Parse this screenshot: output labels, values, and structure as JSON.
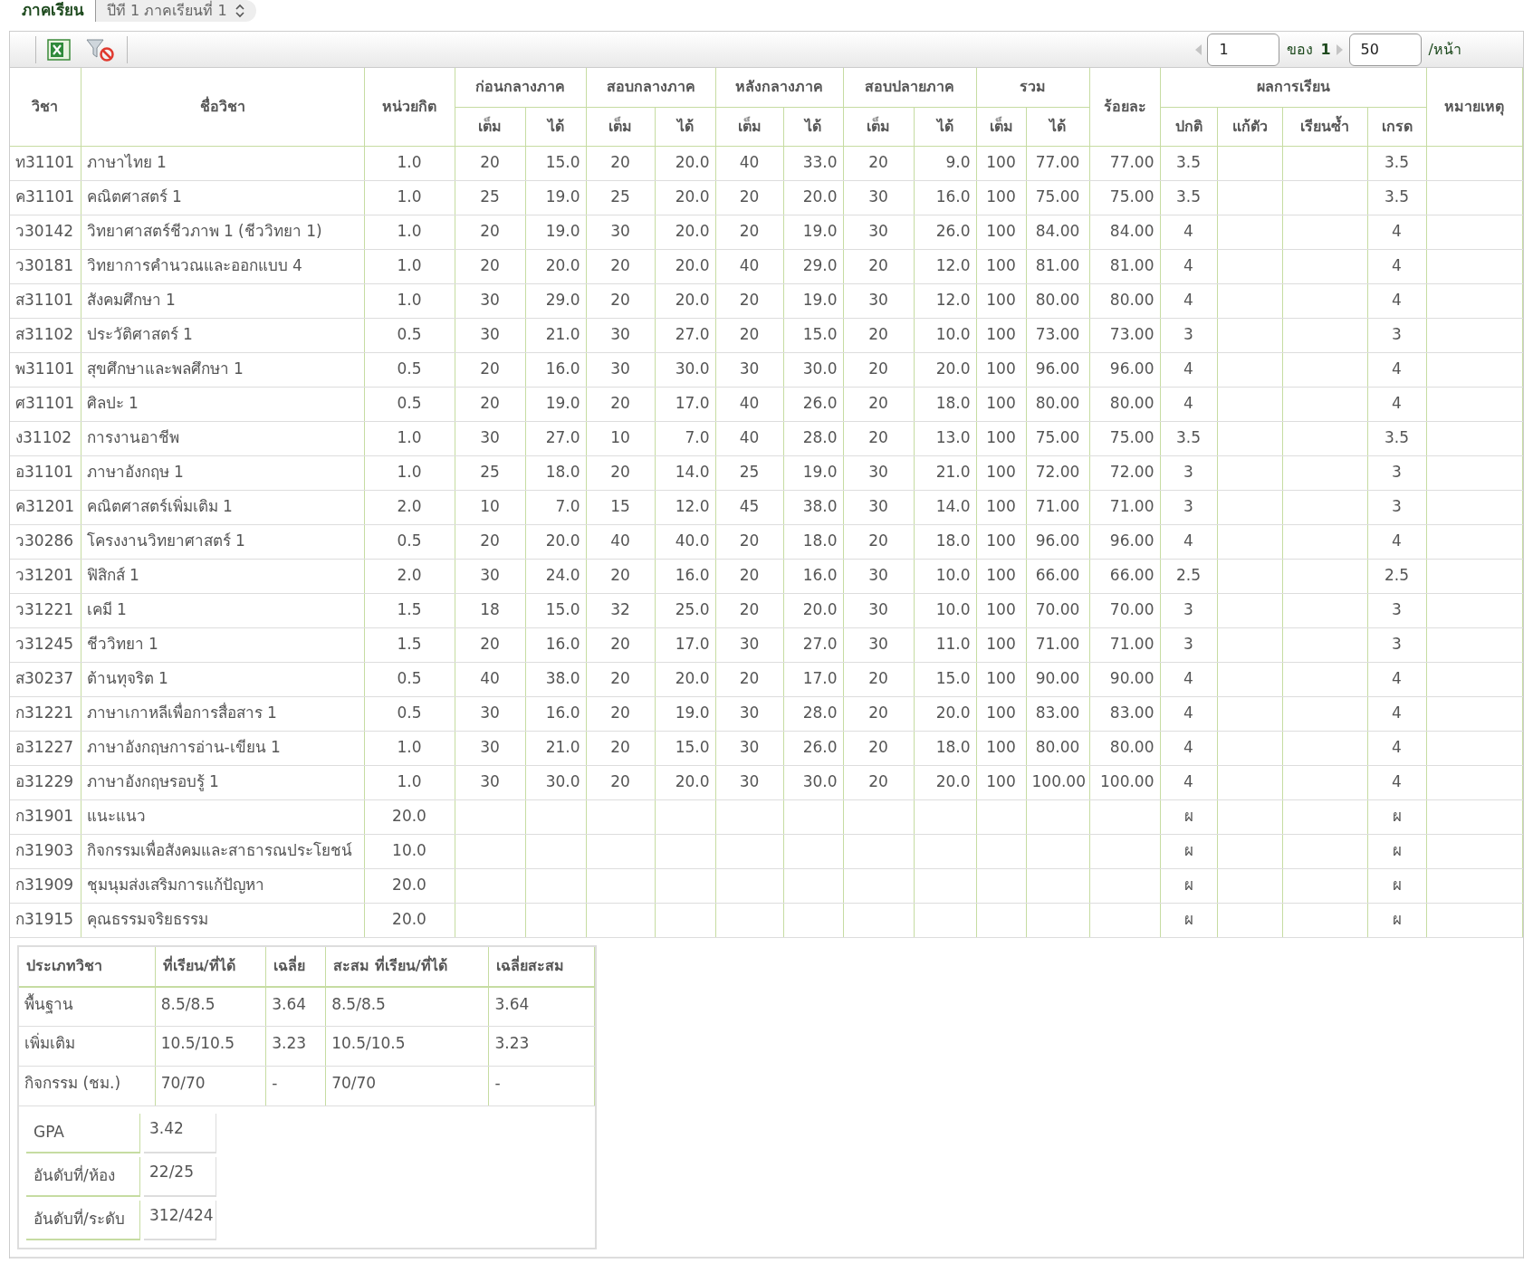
{
  "term": {
    "label": "ภาคเรียน",
    "value": "ปีที 1 ภาคเรียนที่ 1"
  },
  "pager": {
    "page": "1",
    "of": "ของ",
    "total": "1",
    "per_page": "50",
    "unit": "/หน้า"
  },
  "table": {
    "header_groups": [
      {
        "label": "วิชา"
      },
      {
        "label": "ชื่อวิชา"
      },
      {
        "label": "หน่วยกิต"
      },
      {
        "label": "ก่อนกลางภาค",
        "subcolumns": [
          "เต็ม",
          "ได้"
        ]
      },
      {
        "label": "สอบกลางภาค",
        "subcolumns": [
          "เต็ม",
          "ได้"
        ]
      },
      {
        "label": "หลังกลางภาค",
        "subcolumns": [
          "เต็ม",
          "ได้"
        ]
      },
      {
        "label": "สอบปลายภาค",
        "subcolumns": [
          "เต็ม",
          "ได้"
        ]
      },
      {
        "label": "รวม",
        "subcolumns": [
          "เต็ม",
          "ได้"
        ]
      },
      {
        "label": "ร้อยละ"
      },
      {
        "label": "ผลการเรียน",
        "subcolumns": [
          "ปกติ",
          "แก้ตัว",
          "เรียนซ้ำ",
          "เกรด"
        ]
      },
      {
        "label": "หมายเหตุ"
      }
    ],
    "rows": [
      [
        "ท31101",
        "ภาษาไทย 1",
        "1.0",
        "20",
        "15.0",
        "20",
        "20.0",
        "40",
        "33.0",
        "20",
        "9.0",
        "100",
        "77.00",
        "77.00",
        "3.5",
        null,
        null,
        "3.5",
        null
      ],
      [
        "ค31101",
        "คณิตศาสตร์ 1",
        "1.0",
        "25",
        "19.0",
        "25",
        "20.0",
        "20",
        "20.0",
        "30",
        "16.0",
        "100",
        "75.00",
        "75.00",
        "3.5",
        null,
        null,
        "3.5",
        null
      ],
      [
        "ว30142",
        "วิทยาศาสตร์ชีวภาพ 1 (ชีววิทยา 1)",
        "1.0",
        "20",
        "19.0",
        "30",
        "20.0",
        "20",
        "19.0",
        "30",
        "26.0",
        "100",
        "84.00",
        "84.00",
        "4",
        null,
        null,
        "4",
        null
      ],
      [
        "ว30181",
        "วิทยาการคำนวณและออกแบบ 4",
        "1.0",
        "20",
        "20.0",
        "20",
        "20.0",
        "40",
        "29.0",
        "20",
        "12.0",
        "100",
        "81.00",
        "81.00",
        "4",
        null,
        null,
        "4",
        null
      ],
      [
        "ส31101",
        "สังคมศึกษา 1",
        "1.0",
        "30",
        "29.0",
        "20",
        "20.0",
        "20",
        "19.0",
        "30",
        "12.0",
        "100",
        "80.00",
        "80.00",
        "4",
        null,
        null,
        "4",
        null
      ],
      [
        "ส31102",
        "ประวัติศาสตร์ 1",
        "0.5",
        "30",
        "21.0",
        "30",
        "27.0",
        "20",
        "15.0",
        "20",
        "10.0",
        "100",
        "73.00",
        "73.00",
        "3",
        null,
        null,
        "3",
        null
      ],
      [
        "พ31101",
        "สุขศึกษาและพลศึกษา 1",
        "0.5",
        "20",
        "16.0",
        "30",
        "30.0",
        "30",
        "30.0",
        "20",
        "20.0",
        "100",
        "96.00",
        "96.00",
        "4",
        null,
        null,
        "4",
        null
      ],
      [
        "ศ31101",
        "ศิลปะ 1",
        "0.5",
        "20",
        "19.0",
        "20",
        "17.0",
        "40",
        "26.0",
        "20",
        "18.0",
        "100",
        "80.00",
        "80.00",
        "4",
        null,
        null,
        "4",
        null
      ],
      [
        "ง31102",
        "การงานอาชีพ",
        "1.0",
        "30",
        "27.0",
        "10",
        "7.0",
        "40",
        "28.0",
        "20",
        "13.0",
        "100",
        "75.00",
        "75.00",
        "3.5",
        null,
        null,
        "3.5",
        null
      ],
      [
        "อ31101",
        "ภาษาอังกฤษ 1",
        "1.0",
        "25",
        "18.0",
        "20",
        "14.0",
        "25",
        "19.0",
        "30",
        "21.0",
        "100",
        "72.00",
        "72.00",
        "3",
        null,
        null,
        "3",
        null
      ],
      [
        "ค31201",
        "คณิตศาสตร์เพิ่มเติม 1",
        "2.0",
        "10",
        "7.0",
        "15",
        "12.0",
        "45",
        "38.0",
        "30",
        "14.0",
        "100",
        "71.00",
        "71.00",
        "3",
        null,
        null,
        "3",
        null
      ],
      [
        "ว30286",
        "โครงงานวิทยาศาสตร์ 1",
        "0.5",
        "20",
        "20.0",
        "40",
        "40.0",
        "20",
        "18.0",
        "20",
        "18.0",
        "100",
        "96.00",
        "96.00",
        "4",
        null,
        null,
        "4",
        null
      ],
      [
        "ว31201",
        "ฟิสิกส์ 1",
        "2.0",
        "30",
        "24.0",
        "20",
        "16.0",
        "20",
        "16.0",
        "30",
        "10.0",
        "100",
        "66.00",
        "66.00",
        "2.5",
        null,
        null,
        "2.5",
        null
      ],
      [
        "ว31221",
        "เคมี 1",
        "1.5",
        "18",
        "15.0",
        "32",
        "25.0",
        "20",
        "20.0",
        "30",
        "10.0",
        "100",
        "70.00",
        "70.00",
        "3",
        null,
        null,
        "3",
        null
      ],
      [
        "ว31245",
        "ชีววิทยา 1",
        "1.5",
        "20",
        "16.0",
        "20",
        "17.0",
        "30",
        "27.0",
        "30",
        "11.0",
        "100",
        "71.00",
        "71.00",
        "3",
        null,
        null,
        "3",
        null
      ],
      [
        "ส30237",
        "ต้านทุจริต 1",
        "0.5",
        "40",
        "38.0",
        "20",
        "20.0",
        "20",
        "17.0",
        "20",
        "15.0",
        "100",
        "90.00",
        "90.00",
        "4",
        null,
        null,
        "4",
        null
      ],
      [
        "ก31221",
        "ภาษาเกาหลีเพื่อการสื่อสาร 1",
        "0.5",
        "30",
        "16.0",
        "20",
        "19.0",
        "30",
        "28.0",
        "20",
        "20.0",
        "100",
        "83.00",
        "83.00",
        "4",
        null,
        null,
        "4",
        null
      ],
      [
        "อ31227",
        "ภาษาอังกฤษการอ่าน-เขียน 1",
        "1.0",
        "30",
        "21.0",
        "20",
        "15.0",
        "30",
        "26.0",
        "20",
        "18.0",
        "100",
        "80.00",
        "80.00",
        "4",
        null,
        null,
        "4",
        null
      ],
      [
        "อ31229",
        "ภาษาอังกฤษรอบรู้ 1",
        "1.0",
        "30",
        "30.0",
        "20",
        "20.0",
        "30",
        "30.0",
        "20",
        "20.0",
        "100",
        "100.00",
        "100.00",
        "4",
        null,
        null,
        "4",
        null
      ],
      [
        "ก31901",
        "แนะแนว",
        "20.0",
        null,
        null,
        null,
        null,
        null,
        null,
        null,
        null,
        null,
        null,
        null,
        "ผ",
        null,
        null,
        "ผ",
        null
      ],
      [
        "ก31903",
        "กิจกรรมเพื่อสังคมและสาธารณประโยชน์",
        "10.0",
        null,
        null,
        null,
        null,
        null,
        null,
        null,
        null,
        null,
        null,
        null,
        "ผ",
        null,
        null,
        "ผ",
        null
      ],
      [
        "ก31909",
        "ชุมนุมส่งเสริมการแก้ปัญหา",
        "20.0",
        null,
        null,
        null,
        null,
        null,
        null,
        null,
        null,
        null,
        null,
        null,
        "ผ",
        null,
        null,
        "ผ",
        null
      ],
      [
        "ก31915",
        "คุณธรรมจริยธรรม",
        "20.0",
        null,
        null,
        null,
        null,
        null,
        null,
        null,
        null,
        null,
        null,
        null,
        "ผ",
        null,
        null,
        "ผ",
        null
      ]
    ]
  },
  "summary": {
    "columns": [
      "ประเภทวิชา",
      "ที่เรียน/ที่ได้",
      "เฉลี่ย",
      "สะสม ที่เรียน/ที่ได้",
      "เฉลี่ยสะสม"
    ],
    "rows": [
      [
        "พื้นฐาน",
        "8.5/8.5",
        "3.64",
        "8.5/8.5",
        "3.64"
      ],
      [
        "เพิ่มเติม",
        "10.5/10.5",
        "3.23",
        "10.5/10.5",
        "3.23"
      ],
      [
        "กิจกรรม (ชม.)",
        "70/70",
        "-",
        "70/70",
        "-"
      ]
    ],
    "stats": [
      {
        "label": "GPA",
        "value": "3.42"
      },
      {
        "label": "อันดับที่/ห้อง",
        "value": "22/25"
      },
      {
        "label": "อันดับที่/ระดับ",
        "value": "312/424"
      }
    ]
  }
}
